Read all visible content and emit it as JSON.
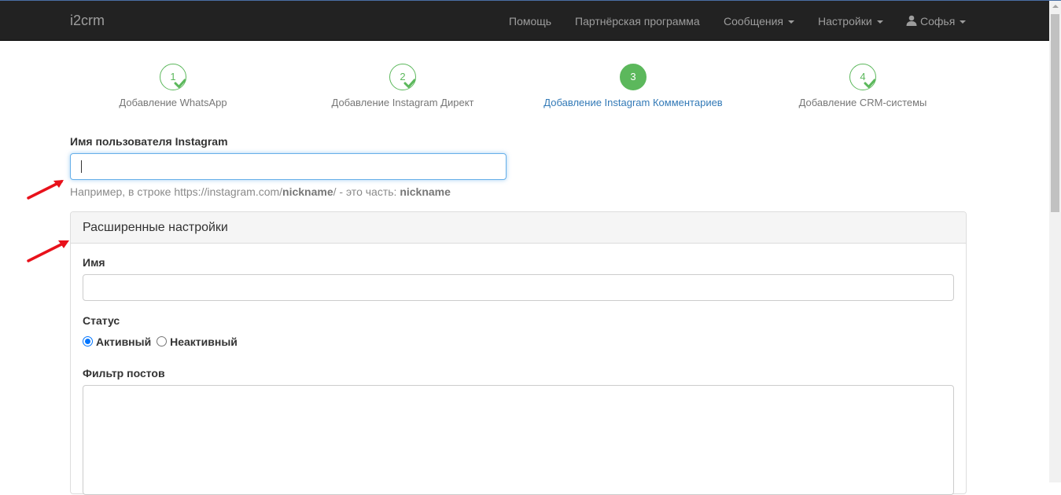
{
  "navbar": {
    "brand": "i2crm",
    "items": [
      {
        "label": "Помощь"
      },
      {
        "label": "Партнёрская программа"
      },
      {
        "label": "Сообщения"
      },
      {
        "label": "Настройки"
      },
      {
        "label": "Софья"
      }
    ]
  },
  "steps": [
    {
      "number": "1",
      "label": "Добавление WhatsApp",
      "state": "done"
    },
    {
      "number": "2",
      "label": "Добавление Instagram Директ",
      "state": "done"
    },
    {
      "number": "3",
      "label": "Добавление Instagram Комментариев",
      "state": "active"
    },
    {
      "number": "4",
      "label": "Добавление CRM-системы",
      "state": "done"
    }
  ],
  "form": {
    "username_label": "Имя пользователя Instagram",
    "username_value": "",
    "help_prefix": "Например, в строке https://instagram.com/",
    "help_nick": "nickname",
    "help_middle": "/ - это часть: ",
    "help_nick2": "nickname"
  },
  "advanced": {
    "title": "Расширенные настройки",
    "name_label": "Имя",
    "name_value": "",
    "status_label": "Статус",
    "status_options": [
      {
        "label": "Активный",
        "checked": true
      },
      {
        "label": "Неактивный",
        "checked": false
      }
    ],
    "filter_label": "Фильтр постов",
    "filter_value": ""
  },
  "colors": {
    "navbar_bg": "#222222",
    "step_green": "#5cb85c",
    "active_link": "#337ab7",
    "annotation_arrow": "#e8111b"
  }
}
